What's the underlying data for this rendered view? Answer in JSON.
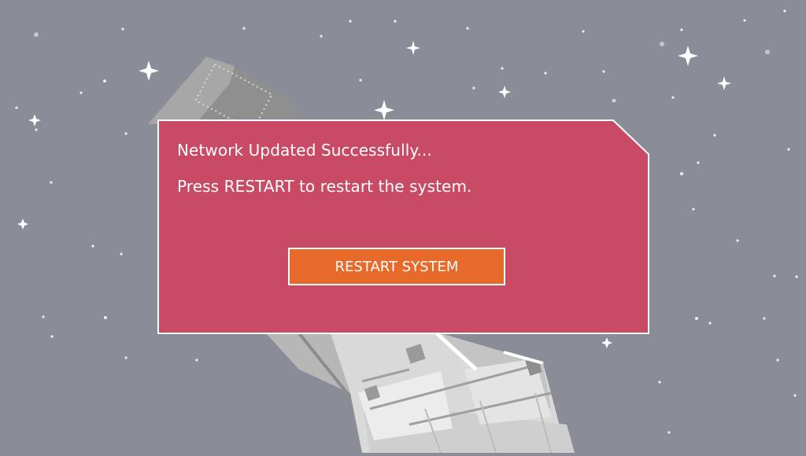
{
  "dialog": {
    "line1": "Network Updated Successfully...",
    "line2": "Press RESTART to restart the system.",
    "restart_label": "RESTART SYSTEM"
  },
  "colors": {
    "background": "#8a8d97",
    "dialog_fill": "#c94a64",
    "button_fill": "#e86a2a",
    "border": "#ffffff"
  },
  "background_icons": [
    "star-icon",
    "telescope-icon"
  ]
}
